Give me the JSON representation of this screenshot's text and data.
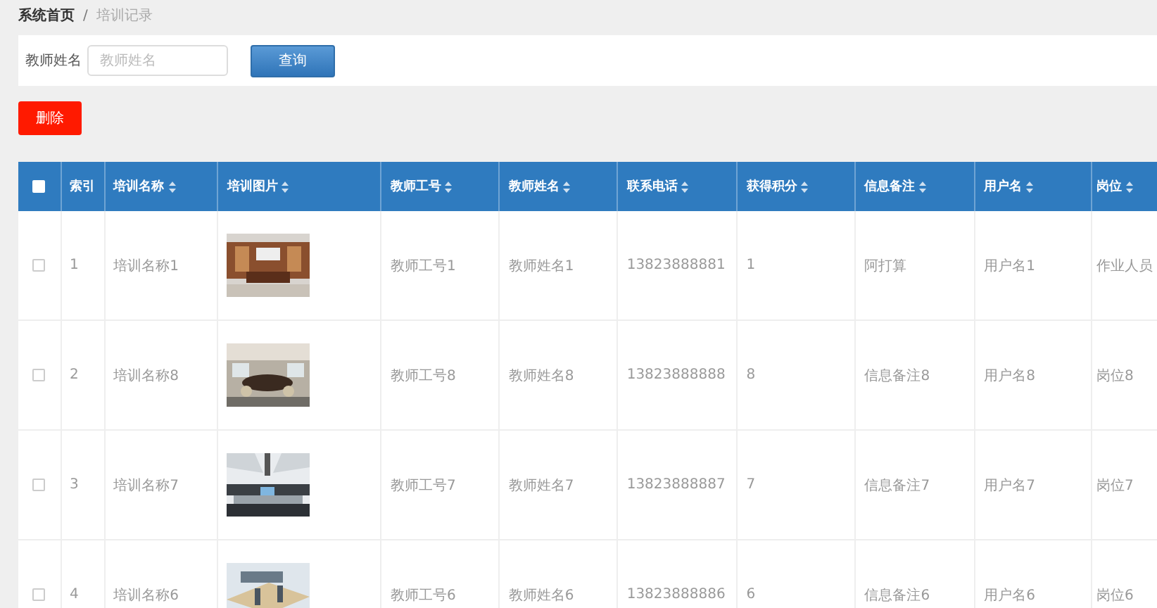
{
  "breadcrumb": {
    "items": [
      {
        "label": "系统首页",
        "current": false
      },
      {
        "label": "培训记录",
        "current": true
      }
    ],
    "separator": "/"
  },
  "search": {
    "label": "教师姓名",
    "placeholder": "教师姓名",
    "button": "查询"
  },
  "actions": {
    "delete_button": "删除"
  },
  "table": {
    "select_all": {
      "checked": false
    },
    "columns": [
      {
        "label": "索引",
        "sortable": false
      },
      {
        "label": "培训名称",
        "sortable": true
      },
      {
        "label": "培训图片",
        "sortable": true
      },
      {
        "label": "教师工号",
        "sortable": true
      },
      {
        "label": "教师姓名",
        "sortable": true
      },
      {
        "label": "联系电话",
        "sortable": true
      },
      {
        "label": "获得积分",
        "sortable": true
      },
      {
        "label": "信息备注",
        "sortable": true
      },
      {
        "label": "用户名",
        "sortable": true
      },
      {
        "label": "岗位",
        "sortable": true
      }
    ],
    "rows": [
      {
        "selected": false,
        "index": "1",
        "name": "培训名称1",
        "teacher_no": "教师工号1",
        "teacher_name": "教师姓名1",
        "phone": "13823888881",
        "points": "1",
        "note": "阿打算",
        "username": "用户名1",
        "position": "作业人员"
      },
      {
        "selected": false,
        "index": "2",
        "name": "培训名称8",
        "teacher_no": "教师工号8",
        "teacher_name": "教师姓名8",
        "phone": "13823888888",
        "points": "8",
        "note": "信息备注8",
        "username": "用户名8",
        "position": "岗位8"
      },
      {
        "selected": false,
        "index": "3",
        "name": "培训名称7",
        "teacher_no": "教师工号7",
        "teacher_name": "教师姓名7",
        "phone": "13823888887",
        "points": "7",
        "note": "信息备注7",
        "username": "用户名7",
        "position": "岗位7"
      },
      {
        "selected": false,
        "index": "4",
        "name": "培训名称6",
        "teacher_no": "教师工号6",
        "teacher_name": "教师姓名6",
        "phone": "13823888886",
        "points": "6",
        "note": "信息备注6",
        "username": "用户名6",
        "position": "岗位6"
      }
    ]
  }
}
